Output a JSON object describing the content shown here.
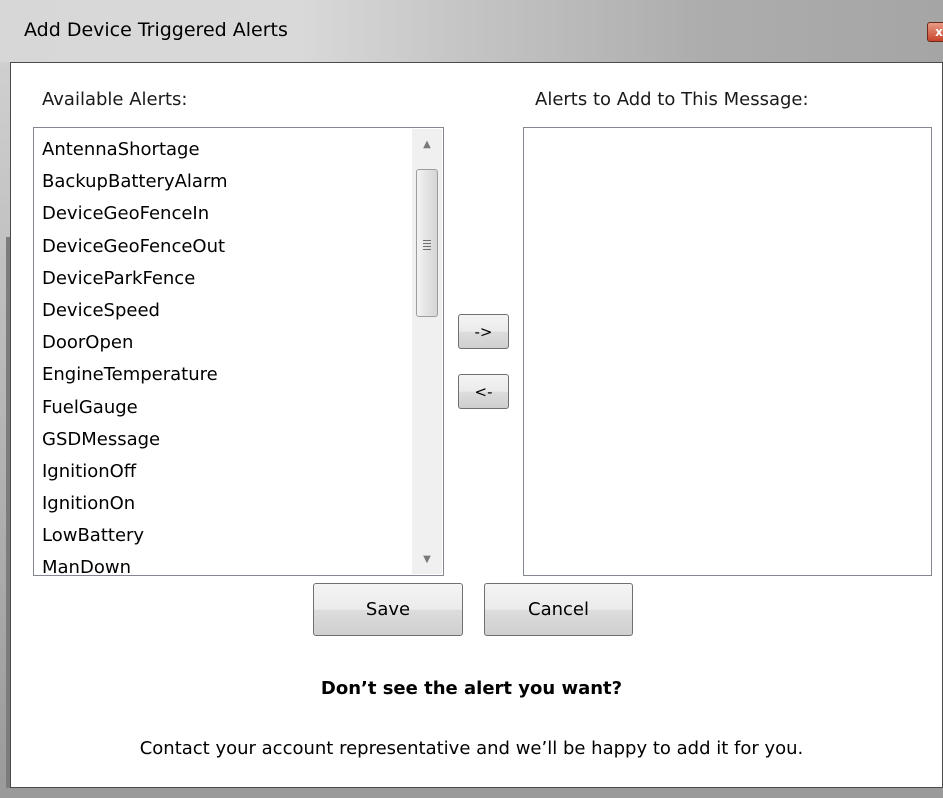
{
  "window": {
    "title": "Add Device Triggered Alerts",
    "close_glyph": "x"
  },
  "available": {
    "label": "Available Alerts:",
    "items": [
      "AntennaShortage",
      "BackupBatteryAlarm",
      "DeviceGeoFenceIn",
      "DeviceGeoFenceOut",
      "DeviceParkFence",
      "DeviceSpeed",
      "DoorOpen",
      "EngineTemperature",
      "FuelGauge",
      "GSDMessage",
      "IgnitionOff",
      "IgnitionOn",
      "LowBattery",
      "ManDown"
    ],
    "scroll_position": 0.15
  },
  "selected": {
    "label": "Alerts to Add to This Message:",
    "items": []
  },
  "transfer": {
    "add_label": "->",
    "remove_label": "<-"
  },
  "actions": {
    "save_label": "Save",
    "cancel_label": "Cancel"
  },
  "footer": {
    "title": "Don’t see the alert you want?",
    "text": "Contact your account representative and we’ll be happy to add it for you."
  }
}
